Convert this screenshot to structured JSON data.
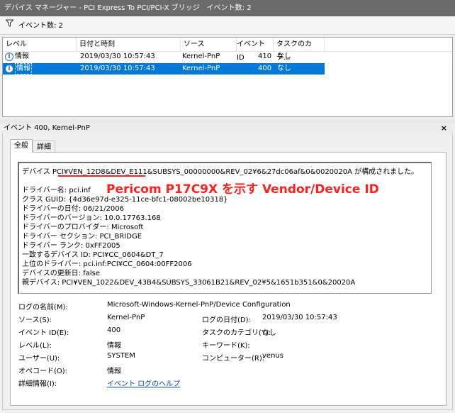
{
  "window": {
    "title": "デバイス マネージャー - PCI Express To PCI/PCI-X ブリッジ　イベント数: 2"
  },
  "filter": {
    "label": "イベント数: 2",
    "icon": "filter-icon"
  },
  "list": {
    "headers": [
      "レベル",
      "日付と時刻",
      "ソース",
      "イベント ID",
      "タスクのカテ..."
    ],
    "rows": [
      {
        "level": "情報",
        "datetime": "2019/03/30 10:57:43",
        "source": "Kernel-PnP",
        "event_id": "410",
        "task": "なし"
      },
      {
        "level": "情報",
        "datetime": "2019/03/30 10:57:43",
        "source": "Kernel-PnP",
        "event_id": "400",
        "task": "なし"
      }
    ]
  },
  "detail": {
    "header": "イベント 400, Kernel-PnP",
    "close_label": "×",
    "tabs": [
      "全般",
      "詳細"
    ],
    "description_lines": [
      "デバイス PCI¥VEN_12D8&DEV_E111&SUBSYS_00000000&REV_02¥6&27dc06af&0&0020020A が構成されました。",
      "",
      "ドライバー名: pci.inf",
      "クラス GUID: {4d36e97d-e325-11ce-bfc1-08002be10318}",
      "ドライバーの日付: 06/21/2006",
      "ドライバーのバージョン: 10.0.17763.168",
      "ドライバーのプロバイダー: Microsoft",
      "ドライバー セクション: PCI_BRIDGE",
      "ドライバー ランク: 0xFF2005",
      "一致するデバイス ID: PCI¥CC_0604&DT_7",
      "上位のドライバー: pci.inf:PCI¥CC_0604:00FF2006",
      "デバイスの更新日: false",
      "親デバイス: PCI¥VEN_1022&DEV_43B4&SUBSYS_33061B21&REV_02¥5&1651b351&0&20020A"
    ],
    "annotation": "Pericom P17C9X を示す Vendor/Device ID",
    "fields": {
      "log_name_label": "ログの名前(M):",
      "log_name_value": "Microsoft-Windows-Kernel-PnP/Device Configuration",
      "source_label": "ソース(S):",
      "source_value": "Kernel-PnP",
      "logged_label": "ログの日付(D):",
      "logged_value": "2019/03/30 10:57:43",
      "event_id_label": "イベント ID(E):",
      "event_id_value": "400",
      "task_label": "タスクのカテゴリ(Y):",
      "task_value": "なし",
      "level_label": "レベル(L):",
      "level_value": "情報",
      "keywords_label": "キーワード(K):",
      "keywords_value": "",
      "user_label": "ユーザー(U):",
      "user_value": "SYSTEM",
      "computer_label": "コンピューター(R):",
      "computer_value": "venus",
      "opcode_label": "オペコード(O):",
      "opcode_value": "情報",
      "more_info_label": "詳細情報(I):",
      "more_info_link": "イベント ログのヘルプ"
    }
  },
  "colors": {
    "selection": "#0078d7",
    "annotation": "#ff2020",
    "titlebar": "#6b6b6b"
  }
}
